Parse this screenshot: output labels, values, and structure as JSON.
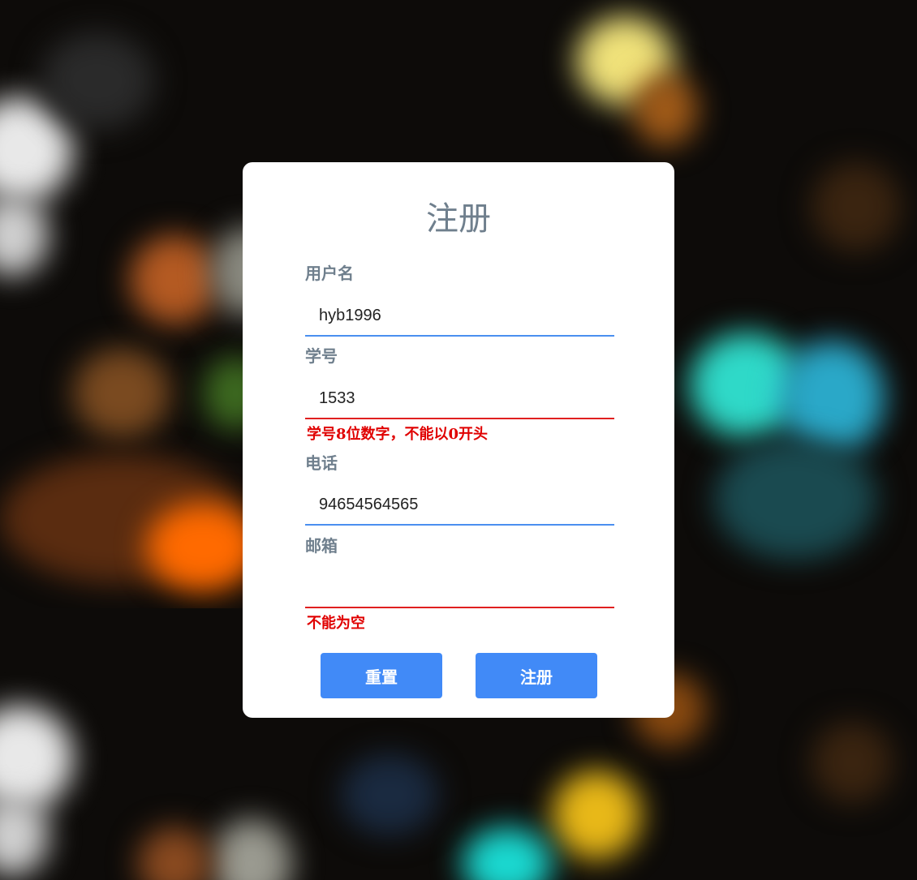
{
  "form": {
    "title": "注册",
    "fields": [
      {
        "label": "用户名",
        "value": "hyb1996",
        "error": ""
      },
      {
        "label": "学号",
        "value": "1533",
        "error": "学号8位数字，不能以0开头"
      },
      {
        "label": "电话",
        "value": "94654564565",
        "error": ""
      },
      {
        "label": "邮箱",
        "value": "",
        "error": "不能为空"
      }
    ],
    "reset_label": "重置",
    "submit_label": "注册"
  },
  "colors": {
    "accent": "#418af7",
    "error": "#e00000",
    "label": "#6f7f8d"
  }
}
